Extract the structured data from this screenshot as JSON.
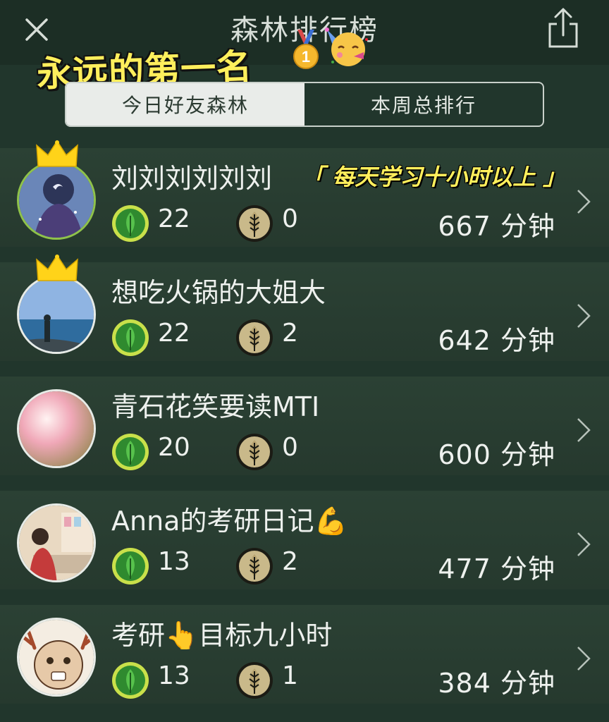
{
  "header": {
    "title": "森林排行榜",
    "sticker_text": "永远的第一名",
    "medal_emoji": "🥇",
    "party_emoji": "🥳"
  },
  "tabs": [
    {
      "label": "今日好友森林",
      "active": true
    },
    {
      "label": "本周总排行",
      "active": false
    }
  ],
  "icons": {
    "close": "close-icon",
    "share": "share-icon",
    "tree": "green-tree-icon",
    "dead_tree": "withered-tree-icon",
    "crown": "crown-icon",
    "chevron": "chevron-right-icon"
  },
  "colors": {
    "background": "#21362c",
    "highlight_text": "#ffef5c",
    "tree_green": "#2f8a2f",
    "tree_ring": "#c9e04a",
    "dead_tree": "#c9b98a"
  },
  "leaderboard": [
    {
      "name": "刘刘刘刘刘刘",
      "tagline": "「 每天学习十小时以上 」",
      "crown": true,
      "trees": "22",
      "dead_trees": "0",
      "minutes": "667 分钟"
    },
    {
      "name": "想吃火锅的大姐大",
      "tagline": "",
      "crown": true,
      "trees": "22",
      "dead_trees": "2",
      "minutes": "642 分钟"
    },
    {
      "name": "青石花笑要读MTI",
      "tagline": "",
      "crown": false,
      "trees": "20",
      "dead_trees": "0",
      "minutes": "600 分钟"
    },
    {
      "name": "Anna的考研日记💪",
      "tagline": "",
      "crown": false,
      "trees": "13",
      "dead_trees": "2",
      "minutes": "477 分钟"
    },
    {
      "name": "考研👆目标九小时",
      "tagline": "",
      "crown": false,
      "trees": "13",
      "dead_trees": "1",
      "minutes": "384 分钟"
    }
  ]
}
